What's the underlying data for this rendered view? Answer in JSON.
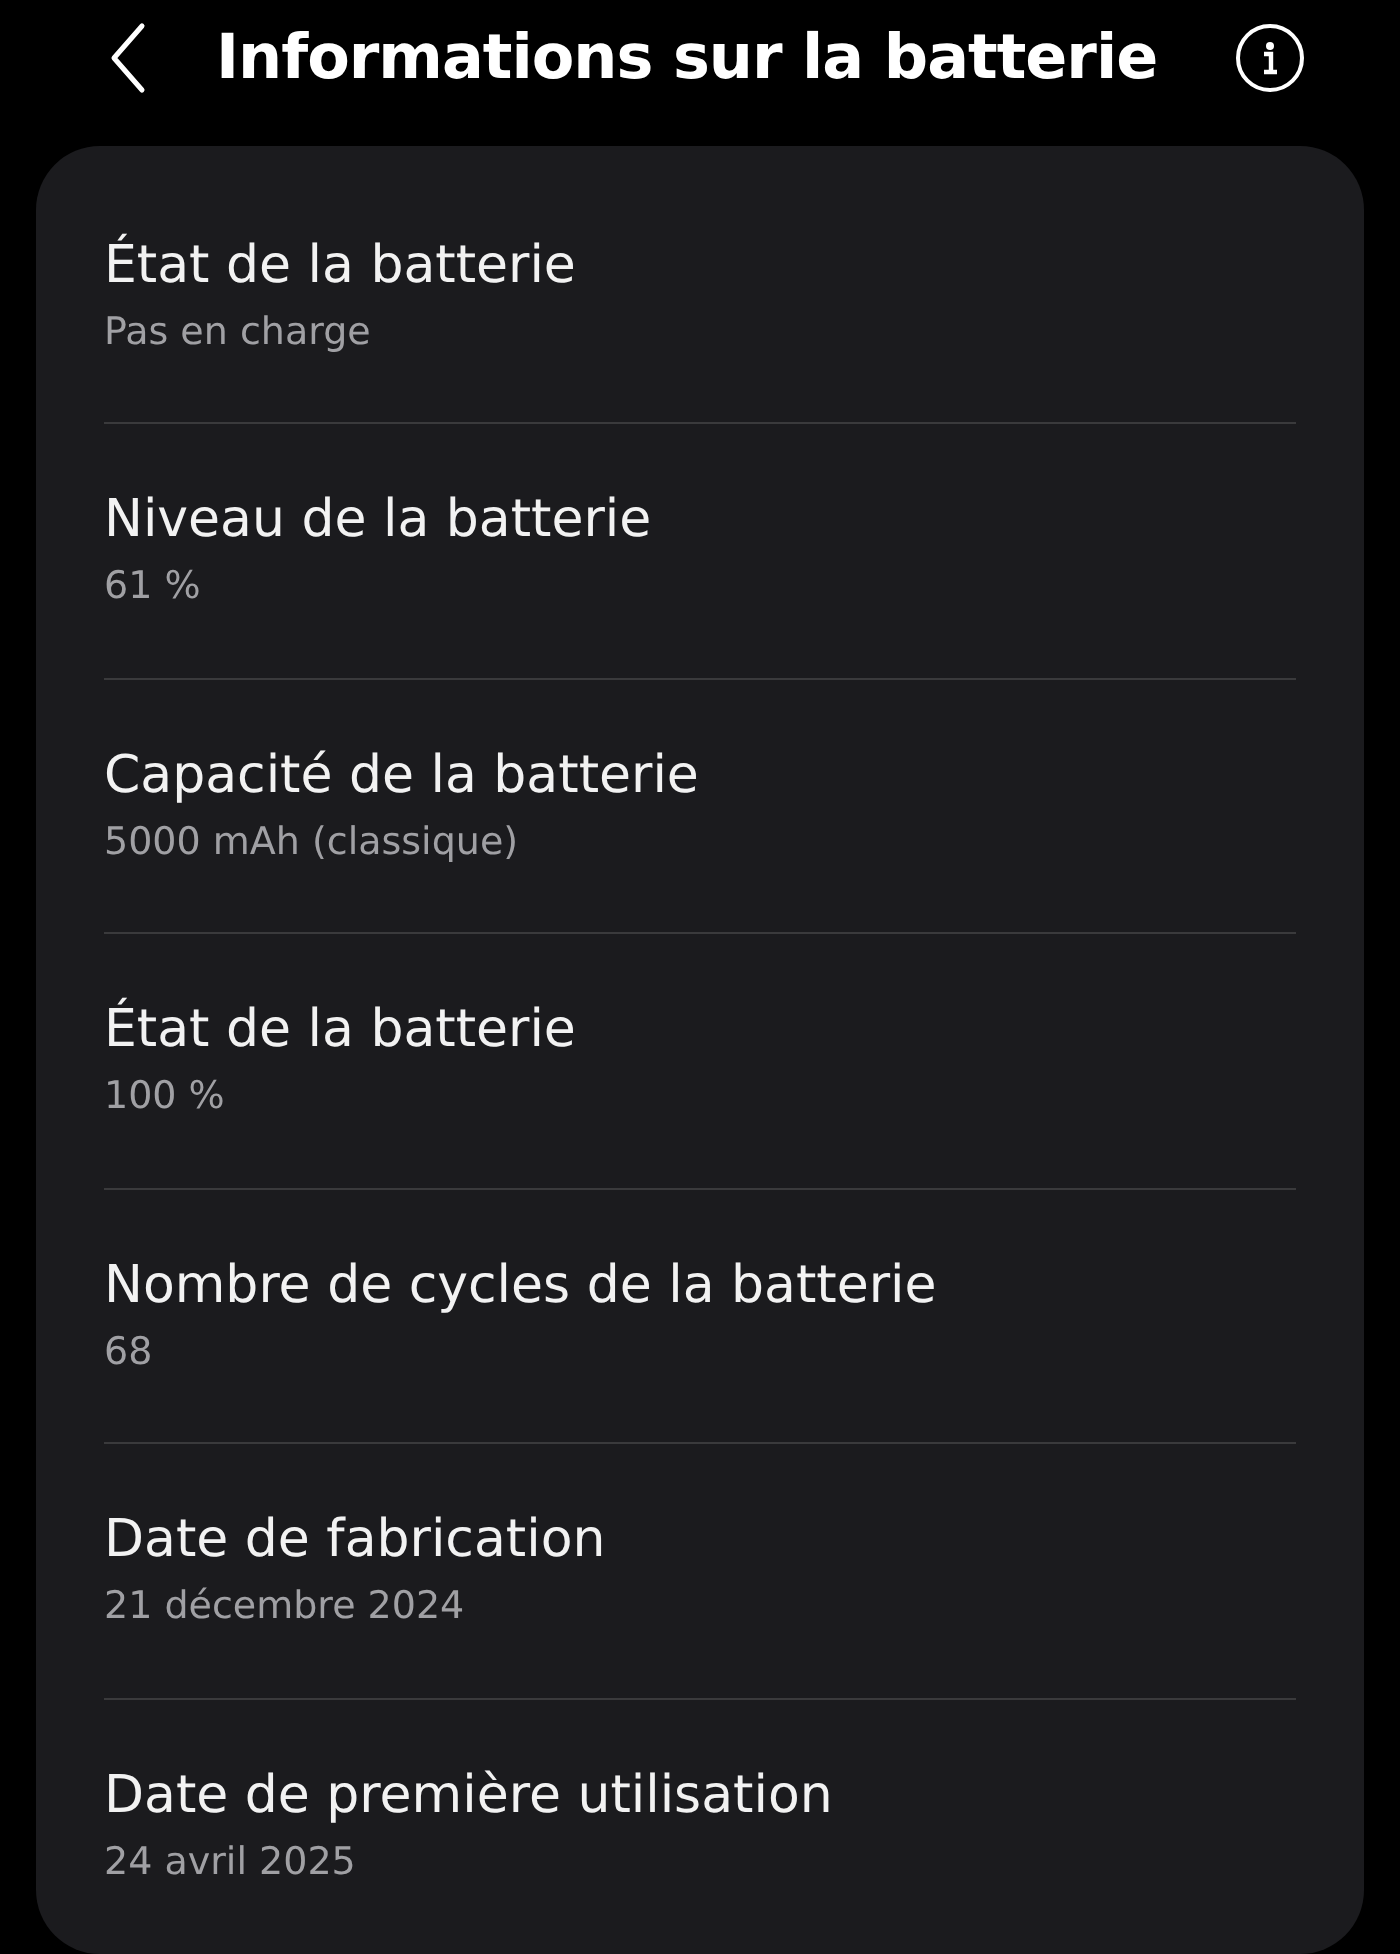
{
  "header": {
    "title": "Informations sur la batterie"
  },
  "items": [
    {
      "label": "État de la batterie",
      "value": "Pas en charge"
    },
    {
      "label": "Niveau de la batterie",
      "value": "61 %"
    },
    {
      "label": "Capacité de la batterie",
      "value": "5000 mAh (classique)"
    },
    {
      "label": "État de la batterie",
      "value": "100 %"
    },
    {
      "label": "Nombre de cycles de la batterie",
      "value": "68"
    },
    {
      "label": "Date de fabrication",
      "value": "21 décembre 2024"
    },
    {
      "label": "Date de première utilisation",
      "value": "24 avril 2025"
    }
  ]
}
